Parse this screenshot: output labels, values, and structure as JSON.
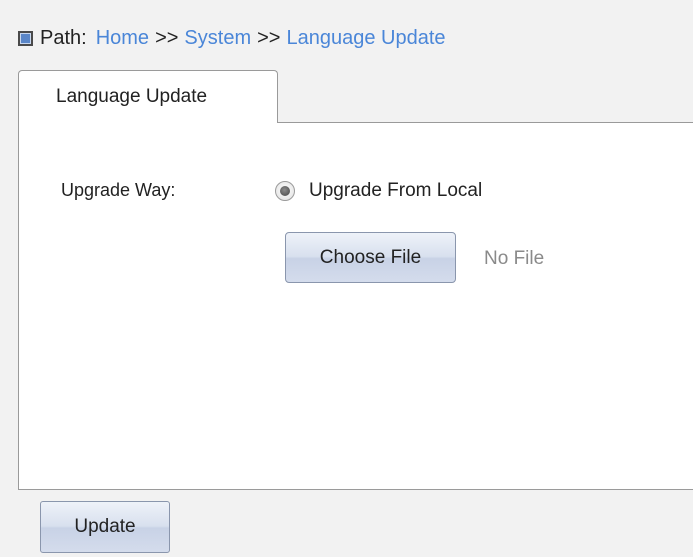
{
  "breadcrumb": {
    "label": "Path:",
    "items": [
      "Home",
      "System",
      "Language Update"
    ],
    "separator": ">>"
  },
  "tab": {
    "label": "Language Update"
  },
  "form": {
    "upgrade_way_label": "Upgrade Way:",
    "radio_label": "Upgrade From Local",
    "radio_selected": true,
    "choose_file_label": "Choose File",
    "file_status": "No File"
  },
  "actions": {
    "update_label": "Update"
  },
  "colors": {
    "link": "#4a86d8",
    "background": "#f2f2f2",
    "panel": "#ffffff",
    "muted_text": "#8a8a8a"
  },
  "icons": {
    "path_icon": "square-bullet-icon",
    "radio_icon": "radio-selected-icon"
  }
}
